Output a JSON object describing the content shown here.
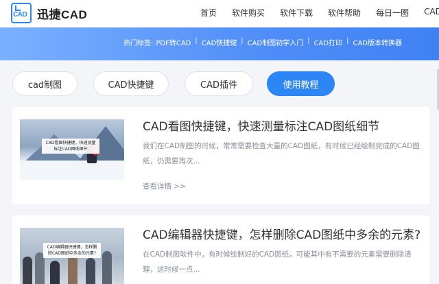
{
  "header": {
    "logo_text": "迅捷CAD",
    "logo_mark_text": "CAD",
    "nav": [
      "首页",
      "软件购买",
      "软件下载",
      "软件帮助",
      "每日一图",
      "CAD"
    ]
  },
  "banner": {
    "hot_label": "热门标签:",
    "tags": [
      "PDF转CAD",
      "CAD快捷键",
      "CAD制图初学入门",
      "CAD打印",
      "CAD版本转换器"
    ],
    "separator": "|"
  },
  "categories": [
    {
      "label": "cad制图",
      "active": false
    },
    {
      "label": "CAD快捷键",
      "active": false
    },
    {
      "label": "CAD插件",
      "active": false
    },
    {
      "label": "使用教程",
      "active": true
    }
  ],
  "articles": [
    {
      "title": "CAD看图快捷键，快速测量标注CAD图纸细节",
      "desc": "我们在CAD制图的时候，常常需要检查大量的CAD图纸，有时候已经绘制完成的CAD图纸，仍需要再次...",
      "more": "查看详情 >>",
      "thumb_caption": "CAD看图快捷键，快速测量标注CAD图纸细节"
    },
    {
      "title": "CAD编辑器快捷键，怎样删除CAD图纸中多余的元素?",
      "desc": "在CAD制图软件中，有时候绘制好的CAD图纸，可能其中有不需要的元素需要删除清理，这时候一点...",
      "thumb_caption": "CAD编辑器快捷键，怎样删除CAD图纸中多余的元素?"
    }
  ],
  "colors": {
    "accent": "#2d86f5",
    "banner_start": "#7cb0ff",
    "banner_end": "#3f82f4"
  }
}
